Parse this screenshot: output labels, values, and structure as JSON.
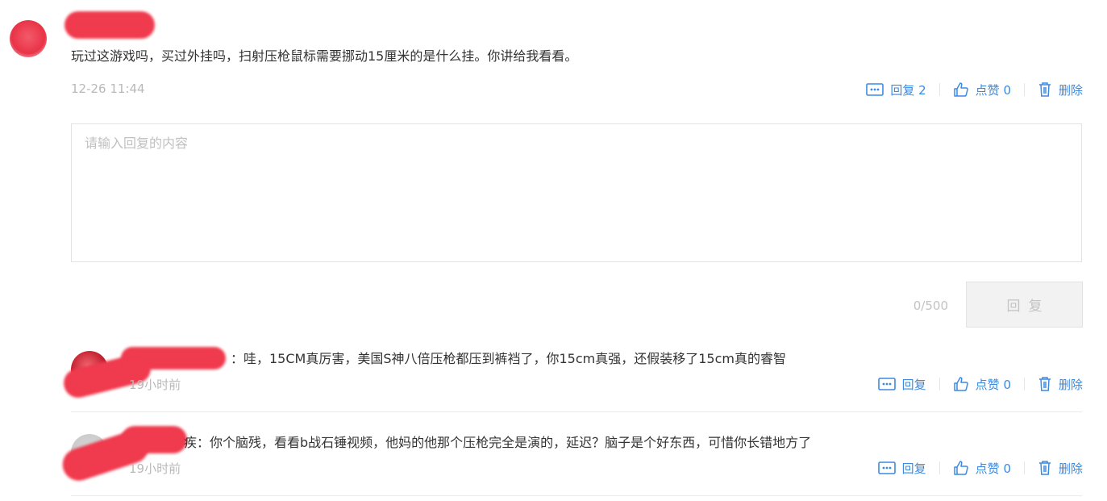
{
  "comment": {
    "text": "玩过这游戏吗，买过外挂吗，扫射压枪鼠标需要挪动15厘米的是什么挂。你讲给我看看。",
    "time": "12-26 11:44",
    "actions": {
      "reply": "回复 2",
      "like": "点赞 0",
      "delete": "删除"
    }
  },
  "reply_box": {
    "placeholder": "请输入回复的内容",
    "counter": "0/500",
    "submit_label": "回复"
  },
  "replies": [
    {
      "text": "：哇，15CM真厉害，美国S神八倍压枪都压到裤裆了，你15cm真强，还假装移了15cm真的睿智",
      "time": "19小时前",
      "actions": {
        "reply": "回复",
        "like": "点赞 0",
        "delete": "删除"
      }
    },
    {
      "text": "疾：你个脑残，看看b战石锤视频，他妈的他那个压枪完全是演的，延迟？脑子是个好东西，可惜你长错地方了",
      "time": "19小时前",
      "actions": {
        "reply": "回复",
        "like": "点赞 0",
        "delete": "删除"
      }
    }
  ],
  "colors": {
    "link_blue": "#3b8ae0",
    "redaction_red": "#f03a4e",
    "muted_gray": "#b9b9b9"
  },
  "icons": [
    "comment-icon",
    "thumbs-up-icon",
    "trash-icon"
  ]
}
